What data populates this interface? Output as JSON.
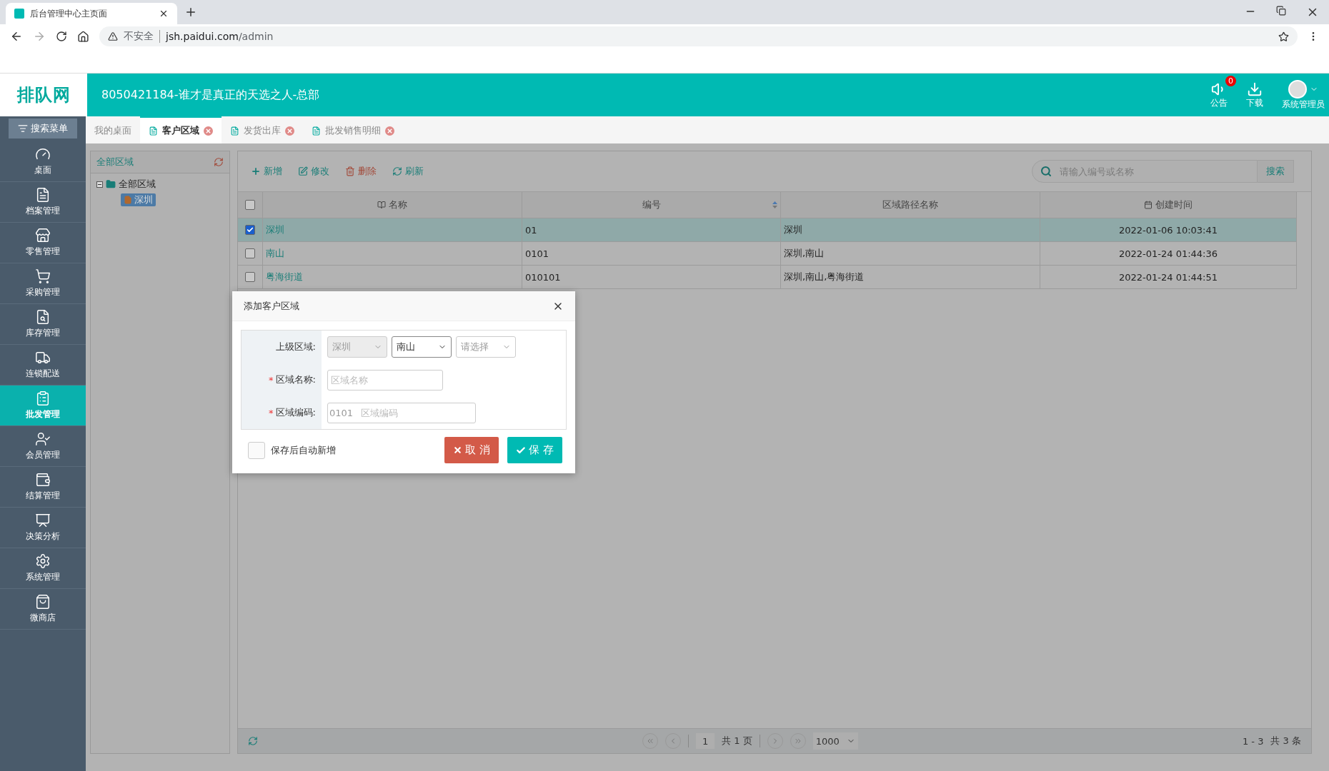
{
  "browser": {
    "tab_title": "后台管理中心主页面",
    "insecure_label": "不安全",
    "url_host": "jsh.paidui.com",
    "url_path": "/admin"
  },
  "header": {
    "logo": "排队网",
    "title": "8050421184-谁才是真正的天选之人-总部",
    "notice": {
      "label": "公告",
      "badge": "0"
    },
    "download": {
      "label": "下载"
    },
    "user": {
      "label": "系统管理员"
    }
  },
  "sidebar": {
    "search_button": "搜索菜单",
    "items": [
      {
        "label": "桌面",
        "kind": "gauge",
        "selected": false
      },
      {
        "label": "档案管理",
        "kind": "file",
        "selected": false
      },
      {
        "label": "零售管理",
        "kind": "store",
        "selected": false
      },
      {
        "label": "采购管理",
        "kind": "cart",
        "selected": false
      },
      {
        "label": "库存管理",
        "kind": "inventory",
        "selected": false
      },
      {
        "label": "连锁配送",
        "kind": "truck",
        "selected": false
      },
      {
        "label": "批发管理",
        "kind": "clipboard",
        "selected": true
      },
      {
        "label": "会员管理",
        "kind": "user",
        "selected": false
      },
      {
        "label": "结算管理",
        "kind": "wallet",
        "selected": false
      },
      {
        "label": "决策分析",
        "kind": "chart",
        "selected": false
      },
      {
        "label": "系统管理",
        "kind": "gear",
        "selected": false
      },
      {
        "label": "微商店",
        "kind": "bag",
        "selected": false
      }
    ]
  },
  "tabs": [
    {
      "label": "我的桌面",
      "selected": false,
      "closable": false
    },
    {
      "label": "客户区域",
      "selected": true,
      "closable": true
    },
    {
      "label": "发货出库",
      "selected": false,
      "closable": true
    },
    {
      "label": "批发销售明细",
      "selected": false,
      "closable": true
    }
  ],
  "tree": {
    "title": "全部区域",
    "root": {
      "label": "全部区域",
      "expanded": true,
      "children": [
        {
          "label": "深圳",
          "selected": true
        }
      ]
    }
  },
  "toolbar": [
    {
      "kind": "add",
      "label": "新增"
    },
    {
      "kind": "edit",
      "label": "修改"
    },
    {
      "kind": "delete",
      "label": "删除"
    },
    {
      "kind": "refresh",
      "label": "刷新"
    }
  ],
  "search": {
    "placeholder": "请输入编号或名称",
    "button": "搜索"
  },
  "table": {
    "all_checked": false,
    "columns": [
      {
        "label": "名称",
        "kind": "book"
      },
      {
        "label": "编号",
        "kind": "sort"
      },
      {
        "label": "区域路径名称",
        "kind": "plain"
      },
      {
        "label": "创建时间",
        "kind": "calendar"
      }
    ],
    "rows": [
      {
        "checked": true,
        "name": "深圳",
        "code": "01",
        "path": "深圳",
        "created": "2022-01-06 10:03:41"
      },
      {
        "checked": false,
        "name": "南山",
        "code": "0101",
        "path": "深圳,南山",
        "created": "2022-01-24 01:44:36"
      },
      {
        "checked": false,
        "name": "粤海街道",
        "code": "010101",
        "path": "深圳,南山,粤海街道",
        "created": "2022-01-24 01:44:51"
      }
    ]
  },
  "pagination": {
    "page": "1",
    "pages_text": "共 1 页",
    "page_size": "1000",
    "range": "1 - 3",
    "total": "共 3 条"
  },
  "dialog": {
    "title": "添加客户区域",
    "parent": {
      "label": "上级区域:",
      "selects": [
        {
          "value": "深圳",
          "disabled": true,
          "focused": false
        },
        {
          "value": "南山",
          "disabled": false,
          "focused": true
        },
        {
          "placeholder": "请选择",
          "disabled": false,
          "focused": false
        }
      ]
    },
    "fields": [
      {
        "required_mark": "*",
        "label": "区域名称:",
        "placeholder": "区域名称"
      },
      {
        "required_mark": "*",
        "label": "区域编码:",
        "prefix": "0101",
        "placeholder": "区域编码"
      }
    ],
    "auto_add": {
      "label": "保存后自动新增",
      "checked": false
    },
    "cancel": "取 消",
    "save": "保 存"
  }
}
